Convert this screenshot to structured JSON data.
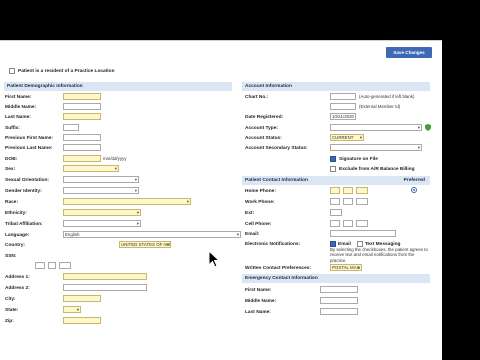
{
  "toolbar": {
    "save_label": "Save Changes"
  },
  "resident": {
    "label": "Patient is a resident of a Practice Location"
  },
  "demographics": {
    "title": "Patient Demographic Information",
    "first_name": "First Name:",
    "middle_name": "Middle Name:",
    "last_name": "Last Name:",
    "suffix": "Suffix:",
    "prev_first": "Previous First Name:",
    "prev_last": "Previous Last Name:",
    "dob": "DOB:",
    "dob_hint": "mm/dd/yyyy",
    "sex": "Sex:",
    "sexual_orientation": "Sexual Orientation:",
    "gender_identity": "Gender Identity:",
    "race": "Race:",
    "ethnicity": "Ethnicity:",
    "tribal": "Tribal Affiliation:",
    "language": "Language:",
    "language_value": "English",
    "country": "Country:",
    "country_value": "UNITED STATES OF AMERICA",
    "ssn": "SSN:",
    "address1": "Address 1:",
    "address2": "Address 2:",
    "city": "City:",
    "state": "State:",
    "zip": "Zip:"
  },
  "account": {
    "title": "Account Information",
    "chart_no": "Chart No.:",
    "chart_hint": "(Auto-generated if left blank)",
    "external_hint": "(External Member Id)",
    "date_registered": "Date Registered:",
    "date_value": "10/21/2020",
    "account_type": "Account Type:",
    "account_status": "Account Status:",
    "account_status_value": "CURRENT",
    "secondary_status": "Account Secondary Status:",
    "signature": "Signature on File",
    "exclude": "Exclude from A/R Balance Billing"
  },
  "contact": {
    "title": "Patient Contact Information",
    "preferred": "Preferred",
    "home_phone": "Home Phone:",
    "work_phone": "Work Phone:",
    "ext": "Ext:",
    "cell_phone": "Cell Phone:",
    "email": "Email:",
    "notifications": "Electronic Notifications:",
    "notif_email": "Email",
    "notif_text": "Text Messaging",
    "notif_note": "By selecting the checkboxes, the patient agrees to receive text and email notifications from the practice.",
    "written_pref": "Written Contact Preferences:",
    "written_value": "POSTAL MAIL"
  },
  "emergency": {
    "title": "Emergency Contact Information",
    "first_name": "First Name:",
    "middle_name": "Middle Name:",
    "last_name": "Last Name:"
  },
  "colors": {
    "accent": "#3f69b6",
    "header_bg": "#dbe6f4",
    "required_bg": "#fff7cc"
  }
}
